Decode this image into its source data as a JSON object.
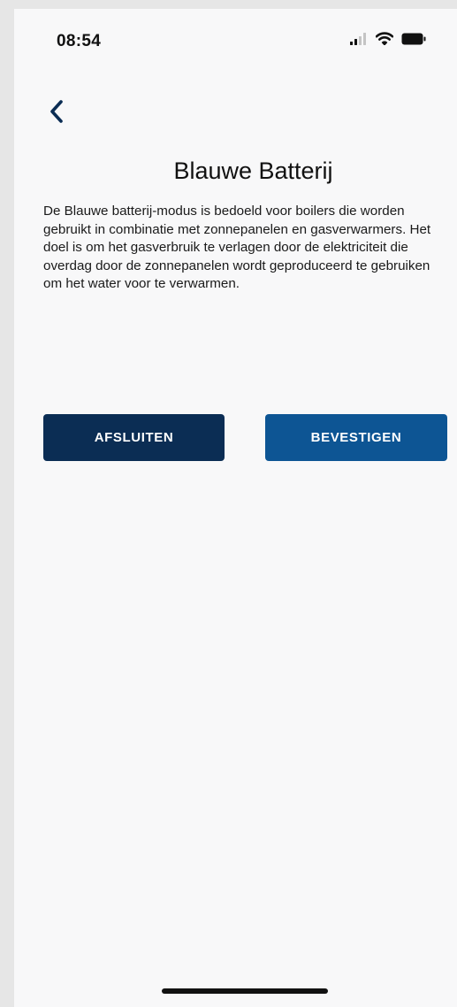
{
  "status_bar": {
    "time": "08:54"
  },
  "header": {
    "title": "Blauwe Batterij"
  },
  "content": {
    "description": "De Blauwe batterij-modus is bedoeld voor boilers die worden gebruikt in combinatie met zonnepanelen en gasverwarmers. Het doel is om het gasverbruik te verlagen door de elektriciteit die overdag door de zonnepanelen wordt geproduceerd te gebruiken om het water voor te verwarmen."
  },
  "actions": {
    "close_label": "AFSLUITEN",
    "confirm_label": "BEVESTIGEN"
  },
  "colors": {
    "close_button": "#0b2d54",
    "confirm_button": "#0d5594",
    "back_chevron": "#0b2d54"
  },
  "icons": {
    "back": "chevron-left-icon",
    "signal": "cellular-signal-icon",
    "wifi": "wifi-icon",
    "battery": "battery-icon"
  }
}
